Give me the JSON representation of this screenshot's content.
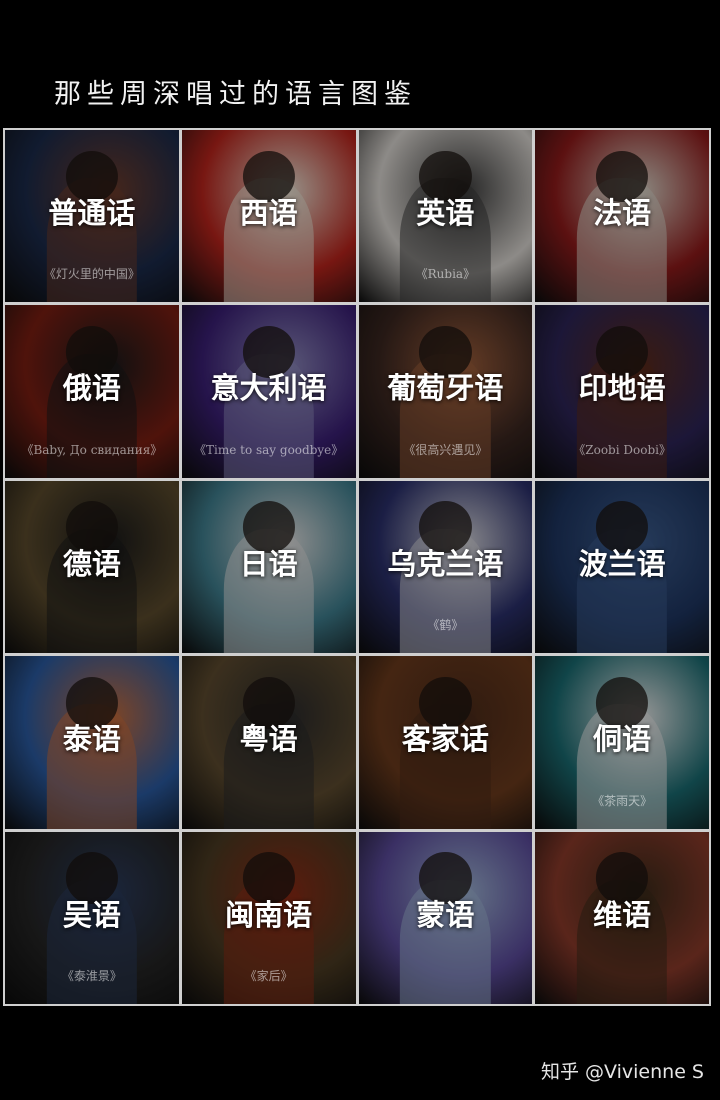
{
  "header": {
    "title": "那些周深唱过的语言图鉴"
  },
  "tiles": [
    {
      "language": "普通话",
      "song": "《灯火里的中国》",
      "bg": "#1b2a4a",
      "accent": "#6b3b2a"
    },
    {
      "language": "西语",
      "song": "",
      "bg": "#b8241c",
      "accent": "#e8e0d2"
    },
    {
      "language": "英语",
      "song": "《Rubia》",
      "bg": "#d9d5d0",
      "accent": "#3a3a3a"
    },
    {
      "language": "法语",
      "song": "",
      "bg": "#8e1b1b",
      "accent": "#d6d0c4"
    },
    {
      "language": "俄语",
      "song": "《Baby, До свидания》",
      "bg": "#7a1e12",
      "accent": "#1a1a1a"
    },
    {
      "language": "意大利语",
      "song": "《Time to say goodbye》",
      "bg": "#3a1f74",
      "accent": "#8a86b8"
    },
    {
      "language": "葡萄牙语",
      "song": "《很高兴遇见》",
      "bg": "#3a2620",
      "accent": "#9a5c3a"
    },
    {
      "language": "印地语",
      "song": "《Zoobi Doobi》",
      "bg": "#2c2456",
      "accent": "#5a2a1a"
    },
    {
      "language": "德语",
      "song": "",
      "bg": "#5a4a2c",
      "accent": "#1a1a1a"
    },
    {
      "language": "日语",
      "song": "",
      "bg": "#3f7e8e",
      "accent": "#dadada"
    },
    {
      "language": "乌克兰语",
      "song": "《鹤》",
      "bg": "#2a2f6a",
      "accent": "#cfcfd6"
    },
    {
      "language": "波兰语",
      "song": "",
      "bg": "#1e3560",
      "accent": "#3a5a8a"
    },
    {
      "language": "泰语",
      "song": "",
      "bg": "#2a5aa0",
      "accent": "#c26a3a"
    },
    {
      "language": "粤语",
      "song": "",
      "bg": "#5c4a2e",
      "accent": "#2a2a2a"
    },
    {
      "language": "客家话",
      "song": "",
      "bg": "#6a3a1c",
      "accent": "#4a2a1a"
    },
    {
      "language": "侗语",
      "song": "《茶雨天》",
      "bg": "#1a6a70",
      "accent": "#e6e6e6"
    },
    {
      "language": "吴语",
      "song": "《泰淮景》",
      "bg": "#242424",
      "accent": "#2a3a5a"
    },
    {
      "language": "闽南语",
      "song": "《家后》",
      "bg": "#4a3a22",
      "accent": "#8a2a14"
    },
    {
      "language": "蒙语",
      "song": "",
      "bg": "#5a4a9a",
      "accent": "#9ab0d0"
    },
    {
      "language": "维语",
      "song": "",
      "bg": "#8a3a2a",
      "accent": "#3a2a1a"
    }
  ],
  "footer": {
    "watermark": "知乎 @Vivienne S"
  }
}
